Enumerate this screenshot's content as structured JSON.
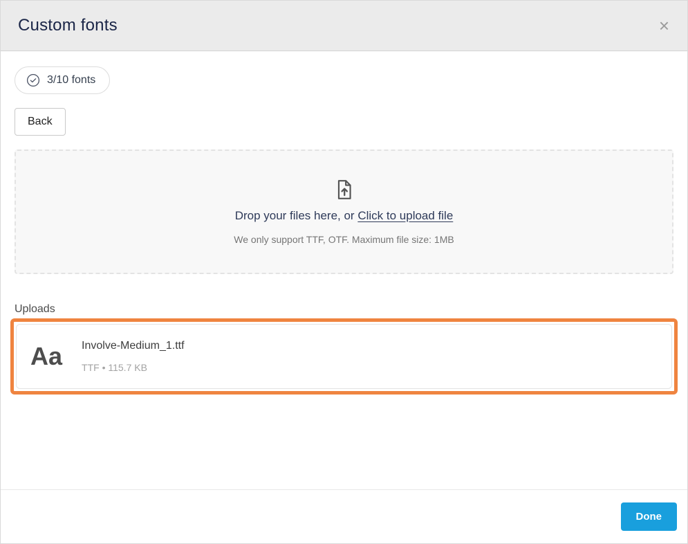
{
  "header": {
    "title": "Custom fonts",
    "close_glyph": "×"
  },
  "toolbar": {
    "fonts_count_badge": "3/10 fonts",
    "back_label": "Back"
  },
  "dropzone": {
    "prompt_text": "Drop your files here, or ",
    "upload_link_label": "Click to upload file",
    "support_note": "We only support TTF, OTF. Maximum file size: 1MB"
  },
  "uploads": {
    "section_label": "Uploads",
    "files": [
      {
        "preview": "Aa",
        "filename": "Involve-Medium_1.ttf",
        "meta": "TTF • 115.7 KB"
      }
    ]
  },
  "footer": {
    "done_label": "Done"
  },
  "colors": {
    "highlight_orange": "#ef8440",
    "accent_blue": "#199fdd",
    "header_bg": "#ebebeb",
    "title_navy": "#1a2547"
  }
}
